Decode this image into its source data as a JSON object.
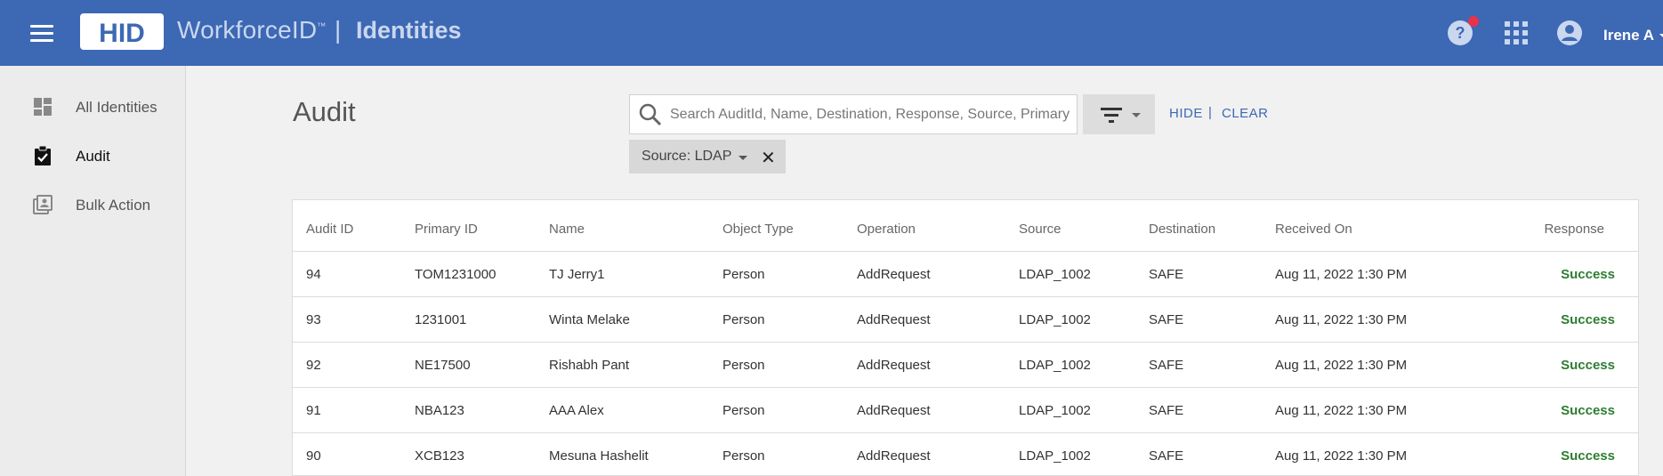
{
  "header": {
    "logo_text": "HID",
    "brand": "WorkforceID",
    "brand_tm": "™",
    "separator": "|",
    "section": "Identities",
    "user_name": "Irene A",
    "icons": {
      "menu": "hamburger-icon",
      "help": "help-icon",
      "apps": "apps-grid-icon",
      "account": "account-circle-icon"
    },
    "notification_color": "#e8334a",
    "brand_color": "#3d68b4"
  },
  "sidebar": {
    "items": [
      {
        "label": "All Identities",
        "icon": "dashboard-icon",
        "active": false
      },
      {
        "label": "Audit",
        "icon": "clipboard-check-icon",
        "active": true
      },
      {
        "label": "Bulk Action",
        "icon": "bulk-action-icon",
        "active": false
      }
    ]
  },
  "main": {
    "title": "Audit",
    "search": {
      "placeholder": "Search AuditId, Name, Destination, Response, Source, Primary ID",
      "value": ""
    },
    "hide_label": "HIDE",
    "separator": "|",
    "clear_label": "CLEAR",
    "filter_chip": {
      "label": "Source: LDAP",
      "close": "✕"
    }
  },
  "table": {
    "columns": [
      "Audit ID",
      "Primary ID",
      "Name",
      "Object Type",
      "Operation",
      "Source",
      "Destination",
      "Received On",
      "Response"
    ],
    "rows": [
      [
        "94",
        "TOM1231000",
        "TJ Jerry1",
        "Person",
        "AddRequest",
        "LDAP_1002",
        "SAFE",
        "Aug 11, 2022 1:30 PM",
        "Success"
      ],
      [
        "93",
        "1231001",
        "Winta Melake",
        "Person",
        "AddRequest",
        "LDAP_1002",
        "SAFE",
        "Aug 11, 2022 1:30 PM",
        "Success"
      ],
      [
        "92",
        "NE17500",
        "Rishabh Pant",
        "Person",
        "AddRequest",
        "LDAP_1002",
        "SAFE",
        "Aug 11, 2022 1:30 PM",
        "Success"
      ],
      [
        "91",
        "NBA123",
        "AAA Alex",
        "Person",
        "AddRequest",
        "LDAP_1002",
        "SAFE",
        "Aug 11, 2022 1:30 PM",
        "Success"
      ],
      [
        "90",
        "XCB123",
        "Mesuna Hashelit",
        "Person",
        "AddRequest",
        "LDAP_1002",
        "SAFE",
        "Aug 11, 2022 1:30 PM",
        "Success"
      ]
    ],
    "success_color": "#2e7d32"
  }
}
